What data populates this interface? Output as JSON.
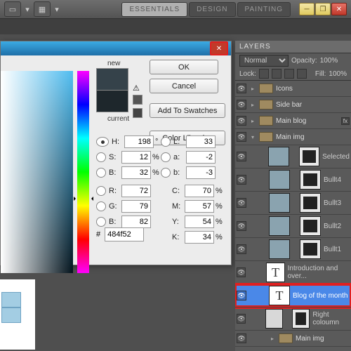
{
  "toolbar": {
    "workspace_tabs": [
      "ESSENTIALS",
      "DESIGN",
      "PAINTING"
    ]
  },
  "color_picker": {
    "new_label": "new",
    "current_label": "current",
    "buttons": {
      "ok": "OK",
      "cancel": "Cancel",
      "add_swatch": "Add To Swatches",
      "libraries": "Color Libraries"
    },
    "fields": {
      "H": {
        "label": "H:",
        "value": "198",
        "unit": "°"
      },
      "S": {
        "label": "S:",
        "value": "12",
        "unit": "%"
      },
      "Bh": {
        "label": "B:",
        "value": "32",
        "unit": "%"
      },
      "R": {
        "label": "R:",
        "value": "72",
        "unit": ""
      },
      "G": {
        "label": "G:",
        "value": "79",
        "unit": ""
      },
      "Bl": {
        "label": "B:",
        "value": "82",
        "unit": ""
      },
      "L": {
        "label": "L:",
        "value": "33",
        "unit": ""
      },
      "a": {
        "label": "a:",
        "value": "-2",
        "unit": ""
      },
      "b": {
        "label": "b:",
        "value": "-3",
        "unit": ""
      },
      "C": {
        "label": "C:",
        "value": "70",
        "unit": "%"
      },
      "M": {
        "label": "M:",
        "value": "57",
        "unit": "%"
      },
      "Y": {
        "label": "Y:",
        "value": "54",
        "unit": "%"
      },
      "K": {
        "label": "K:",
        "value": "34",
        "unit": "%"
      }
    },
    "hex_label": "#",
    "hex_value": "484f52"
  },
  "layers_panel": {
    "tab": "LAYERS",
    "blend_mode": "Normal",
    "opacity_label": "Opacity:",
    "opacity_value": "100%",
    "lock_label": "Lock:",
    "fill_label": "Fill:",
    "fill_value": "100%",
    "groups": {
      "icons": "Icons",
      "sidebar": "Side bar",
      "mainblog": "Main blog",
      "mainimg": "Main img"
    },
    "layers": {
      "selected": "Selected",
      "bullet4": "Bullt4",
      "bullet3": "Bullt3",
      "bullet2": "Bullt2",
      "bullet1": "Bullt1",
      "intro": "Introduction and over...",
      "blog_month": "Blog of the month",
      "right_col": "Right coloumn",
      "mainimg2": "Main img"
    }
  }
}
